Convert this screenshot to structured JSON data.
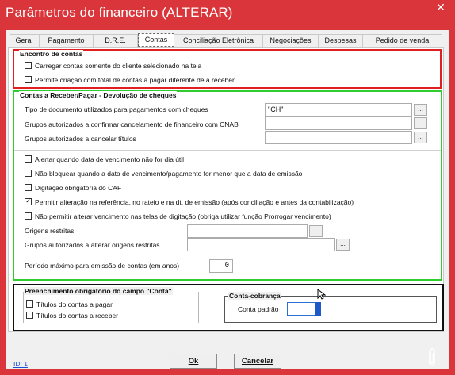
{
  "window": {
    "title": "Parâmetros do financeiro (ALTERAR)",
    "close_glyph": "✕",
    "colors": {
      "frame": "#d9353a",
      "client": "#f0f0f0",
      "highlight_red": "#e02020",
      "highlight_green": "#2ecc2e",
      "highlight_black": "#111111",
      "link": "#1a4fd0"
    }
  },
  "tabs": [
    {
      "label": "Geral",
      "active": false
    },
    {
      "label": "Pagamento",
      "active": false
    },
    {
      "label": "D.R.E.",
      "active": false
    },
    {
      "label": "Contas",
      "active": true
    },
    {
      "label": "Conciliação Eletrônica",
      "active": false
    },
    {
      "label": "Negociações",
      "active": false
    },
    {
      "label": "Despesas",
      "active": false
    },
    {
      "label": "Pedido de venda",
      "active": false
    }
  ],
  "encontro": {
    "title": "Encontro de contas",
    "options": [
      {
        "label": "Carregar contas somente do cliente selecionado na tela",
        "checked": false
      },
      {
        "label": "Permite criação com total de contas a pagar diferente de a receber",
        "checked": false
      }
    ]
  },
  "contas": {
    "title": "Contas a Receber/Pagar - Devolução de cheques",
    "tipo_doc_label": "Tipo de documento utilizados para pagamentos com cheques",
    "tipo_doc_value": "\"CH\"",
    "grupos_cancel_cnab_label": "Grupos autorizados a confirmar cancelamento de financeiro com CNAB",
    "grupos_cancel_titulos_label": "Grupos autorizados a cancelar títulos",
    "dots": "...",
    "options": [
      {
        "label": "Alertar quando data de vencimento não for dia útil",
        "checked": false
      },
      {
        "label": "Não bloquear quando a data de vencimento/pagamento for menor que a data de emissão",
        "checked": false
      },
      {
        "label": "Digitação obrigatória do CAF",
        "checked": false
      },
      {
        "label": "Permitir alteração na referência, no rateio e na dt. de emissão (após conciliação e antes da contabilização)",
        "checked": true
      },
      {
        "label": "Não permitir alterar vencimento nas telas de digitação (obriga utilizar função Prorrogar vencimento)",
        "checked": false
      }
    ],
    "origens_restritas_label": "Origens restritas",
    "grupos_origens_label": "Grupos autorizados a alterar origens restritas",
    "periodo_label": "Período máximo para emissão de contas (em anos)",
    "periodo_value": "0"
  },
  "preenchimento": {
    "title": "Preenchimento obrigatório do campo \"Conta\"",
    "options": [
      {
        "label": "Títulos do contas a pagar",
        "checked": false
      },
      {
        "label": "Títulos do contas a receber",
        "checked": false
      }
    ]
  },
  "conta_cobranca": {
    "title": "Conta-cobrança",
    "label": "Conta padrão",
    "value": ""
  },
  "footer": {
    "id_link": "ID: 1",
    "ok_label": "Ok",
    "cancel_label": "Cancelar",
    "clip_icon": "paperclip-icon"
  }
}
